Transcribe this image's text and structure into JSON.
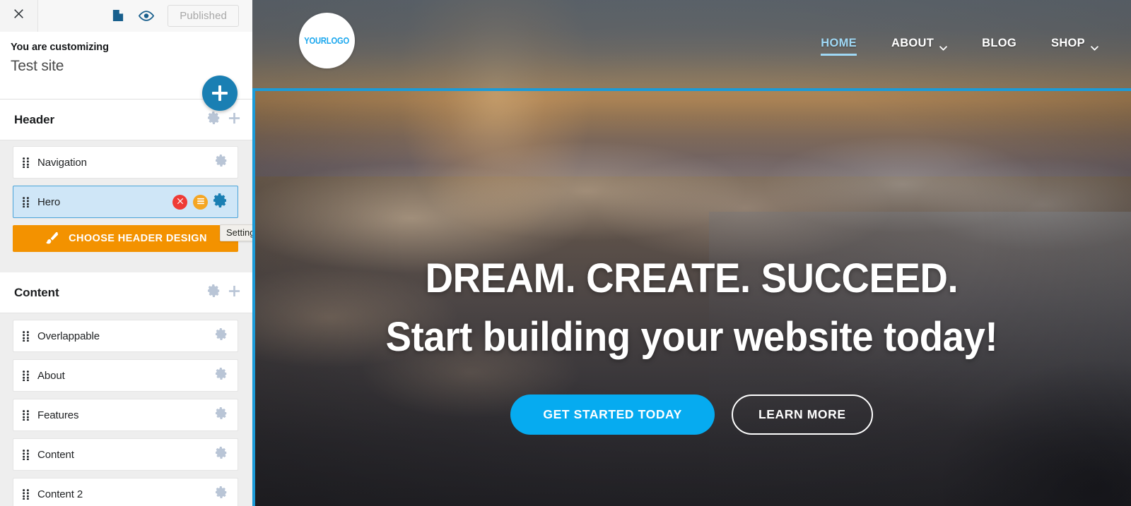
{
  "sidebar": {
    "topbar": {
      "close_icon": "close-icon",
      "document_icon": "document-icon",
      "preview_icon": "eye-icon",
      "status_label": "Published"
    },
    "customizing": {
      "kicker": "You are customizing",
      "site_name": "Test site",
      "add_button_icon": "plus-icon"
    },
    "sections": [
      {
        "title": "Header",
        "gear_icon": "gear-icon",
        "add_icon": "plus-icon",
        "rows": [
          {
            "label": "Navigation",
            "selected": false,
            "gear_icon": "gear-icon"
          },
          {
            "label": "Hero",
            "selected": true,
            "delete_icon": "close-circle-icon",
            "menu_icon": "hamburger-circle-icon",
            "gear_icon": "gear-icon"
          }
        ],
        "cta": {
          "label": "CHOOSE HEADER DESIGN",
          "icon": "paintbrush-icon"
        }
      },
      {
        "title": "Content",
        "gear_icon": "gear-icon",
        "add_icon": "plus-icon",
        "rows": [
          {
            "label": "Overlappable",
            "selected": false,
            "gear_icon": "gear-icon"
          },
          {
            "label": "About",
            "selected": false,
            "gear_icon": "gear-icon"
          },
          {
            "label": "Features",
            "selected": false,
            "gear_icon": "gear-icon"
          },
          {
            "label": "Content",
            "selected": false,
            "gear_icon": "gear-icon"
          },
          {
            "label": "Content 2",
            "selected": false,
            "gear_icon": "gear-icon"
          }
        ]
      }
    ],
    "tooltip": {
      "text": "Settings"
    }
  },
  "preview": {
    "logo": {
      "text": "YOURLOGO"
    },
    "menu": [
      {
        "label": "HOME",
        "active": true,
        "has_dropdown": false
      },
      {
        "label": "ABOUT",
        "active": false,
        "has_dropdown": true
      },
      {
        "label": "BLOG",
        "active": false,
        "has_dropdown": false
      },
      {
        "label": "SHOP",
        "active": false,
        "has_dropdown": true
      }
    ],
    "hero": {
      "line1": "DREAM. CREATE. SUCCEED.",
      "line2": "Start building your website today!",
      "primary_cta": "GET STARTED TODAY",
      "secondary_cta": "LEARN MORE"
    }
  },
  "colors": {
    "accent_blue": "#06abf0",
    "fab_blue": "#1a7fb3",
    "highlight_blue": "#1b9bd8",
    "cta_orange": "#f39200",
    "delete_red": "#ef3b36",
    "menu_orange": "#f5a623",
    "selected_row_bg": "#cfe6f7",
    "nav_active": "#9fd8f5"
  }
}
